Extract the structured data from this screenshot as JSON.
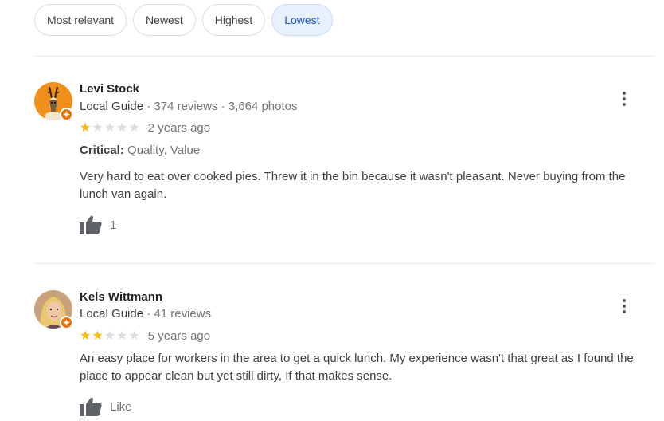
{
  "sort_chips": [
    {
      "label": "Most relevant",
      "active": false
    },
    {
      "label": "Newest",
      "active": false
    },
    {
      "label": "Highest",
      "active": false
    },
    {
      "label": "Lowest",
      "active": true
    }
  ],
  "colors": {
    "star_filled": "#fbbc04",
    "star_empty": "#dadce0",
    "active_chip_bg": "#e8f0fe",
    "guide_badge": "#e8710a"
  },
  "reviews": [
    {
      "name": "Levi Stock",
      "guide_label": "Local Guide",
      "stats": " · 374 reviews · 3,664 photos",
      "rating": 1,
      "date": "2 years ago",
      "critical_label": "Critical:",
      "critical_value": " Quality, Value",
      "text": "Very hard to eat over cooked pies. Threw it in the bin because it wasn't pleasant. Never buying from the lunch van again.",
      "like_label": "1"
    },
    {
      "name": "Kels Wittmann",
      "guide_label": "Local Guide",
      "stats": " · 41 reviews",
      "rating": 2,
      "date": "5 years ago",
      "text": "An easy place for workers in the area to get a quick lunch.  My experience wasn't that great as I found the place to appear clean but yet still dirty, If that makes sense.",
      "like_label": "Like"
    }
  ]
}
